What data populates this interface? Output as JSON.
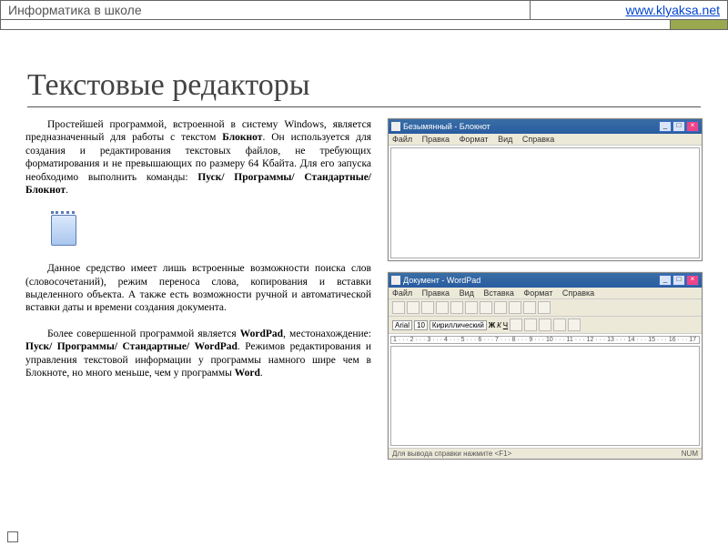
{
  "header": {
    "left": "Информатика в школе",
    "link_text": "www.klyaksa.net",
    "link_href": "http://www.klyaksa.net"
  },
  "title": "Текстовые редакторы",
  "paragraphs": {
    "p1_a": "Простейшей программой, встроенной в систему Windows, является предназначенный для работы с текстом ",
    "p1_b": "Блокнот",
    "p1_c": ". Он используется для создания и редактирования текстовых файлов, не требующих форматирования и не превышающих по размеру 64 Кбайта. Для его запуска необходимо выполнить команды: ",
    "p1_d": "Пуск/ Программы/ Стандартные/ Блокнот",
    "p1_e": ".",
    "p2": "Данное средство имеет лишь встроенные возможности поиска слов (словосочетаний), режим переноса слова, копирования и вставки выделенного объекта. А также есть возможности ручной и автоматической вставки даты и времени создания документа.",
    "p3_a": "Более совершенной программой является ",
    "p3_b": "WordPad",
    "p3_c": ", местонахождение: ",
    "p3_d": "Пуск/ Программы/ Стандартные/ WordPad",
    "p3_e": ". Режимов редактирования и управления текстовой информации у программы намного шире чем в Блокноте, но много меньше, чем у программы ",
    "p3_f": "Word",
    "p3_g": "."
  },
  "notepad_window": {
    "title": "Безымянный - Блокнот",
    "menu": {
      "m1": "Файл",
      "m2": "Правка",
      "m3": "Формат",
      "m4": "Вид",
      "m5": "Справка"
    }
  },
  "wordpad_window": {
    "title": "Документ - WordPad",
    "menu": {
      "m1": "Файл",
      "m2": "Правка",
      "m3": "Вид",
      "m4": "Вставка",
      "m5": "Формат",
      "m6": "Справка"
    },
    "font": "Arial",
    "size": "10",
    "charset": "Кириллический",
    "ruler": "1 · · · 2 · · · 3 · · · 4 · · · 5 · · · 6 · · · 7 · · · 8 · · · 9 · · · 10 · · · 11 · · · 12 · · · 13 · · · 14 · · · 15 · · · 16 · · · 17",
    "status_left": "Для вывода справки нажмите <F1>",
    "status_right": "NUM"
  }
}
